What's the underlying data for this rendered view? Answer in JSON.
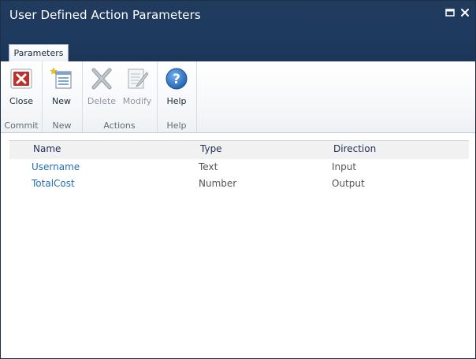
{
  "window": {
    "title": "User Defined Action Parameters"
  },
  "ribbon": {
    "tab_label": "Parameters",
    "groups": {
      "commit": {
        "label": "Commit",
        "close_label": "Close"
      },
      "new": {
        "label": "New",
        "new_label": "New"
      },
      "actions": {
        "label": "Actions",
        "delete_label": "Delete",
        "modify_label": "Modify"
      },
      "help": {
        "label": "Help",
        "help_label": "Help"
      }
    }
  },
  "table": {
    "headers": {
      "name": "Name",
      "type": "Type",
      "direction": "Direction"
    },
    "rows": [
      {
        "name": "Username",
        "type": "Text",
        "direction": "Input"
      },
      {
        "name": "TotalCost",
        "type": "Number",
        "direction": "Output"
      }
    ]
  },
  "colors": {
    "titlebar": "#1e3a5f",
    "link": "#1f6fb5",
    "close_icon": "#c0302b",
    "help_icon": "#2a6fc0"
  }
}
